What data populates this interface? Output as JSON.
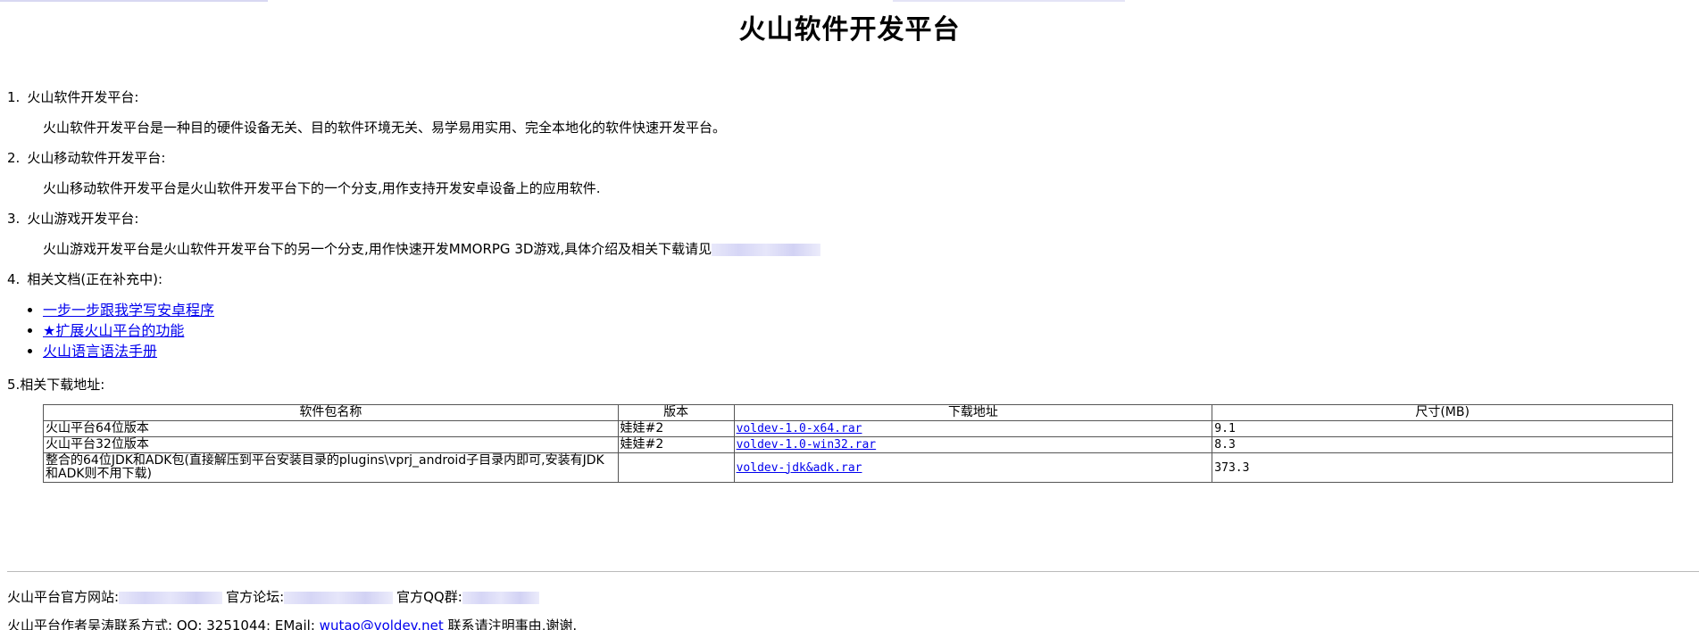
{
  "page_title": "火山软件开发平台",
  "sections": [
    {
      "num": "1.",
      "heading": "火山软件开发平台:",
      "desc": "火山软件开发平台是一种目的硬件设备无关、目的软件环境无关、易学易用实用、完全本地化的软件快速开发平台。"
    },
    {
      "num": "2.",
      "heading": "火山移动软件开发平台:",
      "desc": "火山移动软件开发平台是火山软件开发平台下的一个分支,用作支持开发安卓设备上的应用软件."
    },
    {
      "num": "3.",
      "heading": "火山游戏开发平台:",
      "desc": "火山游戏开发平台是火山软件开发平台下的另一个分支,用作快速开发MMORPG 3D游戏,具体介绍及相关下载请见"
    },
    {
      "num": "4.",
      "heading": "相关文档(正在补充中):"
    }
  ],
  "docs": [
    {
      "label": "一步一步跟我学写安卓程序"
    },
    {
      "label": "★扩展火山平台的功能"
    },
    {
      "label": "火山语言语法手册"
    }
  ],
  "downloads": {
    "heading": "5.相关下载地址:",
    "headers": [
      "软件包名称",
      "版本",
      "下载地址",
      "尺寸(MB)"
    ],
    "rows": [
      {
        "name": "火山平台64位版本",
        "version": "娃娃#2",
        "link": "voldev-1.0-x64.rar",
        "size": "9.1"
      },
      {
        "name": "火山平台32位版本",
        "version": "娃娃#2",
        "link": "voldev-1.0-win32.rar",
        "size": "8.3"
      },
      {
        "name": "整合的64位JDK和ADK包(直接解压到平台安装目录的plugins\\vprj_android子目录内即可,安装有JDK和ADK则不用下载)",
        "version": "",
        "link": "voldev-jdk&adk.rar",
        "size": "373.3"
      }
    ]
  },
  "footer": {
    "site_label": "火山平台官方网站:",
    "forum_label": "官方论坛:",
    "qq_group_label": "官方QQ群:",
    "contact_text": "火山平台作者吴涛联系方式: QQ: 3251044; EMail:",
    "email": "wutao@voldev.net",
    "contact_suffix": "联系请注明事由,谢谢."
  },
  "colors": {
    "link": "#0000ee",
    "border": "#555555",
    "redacted": "#d6d6f6"
  }
}
